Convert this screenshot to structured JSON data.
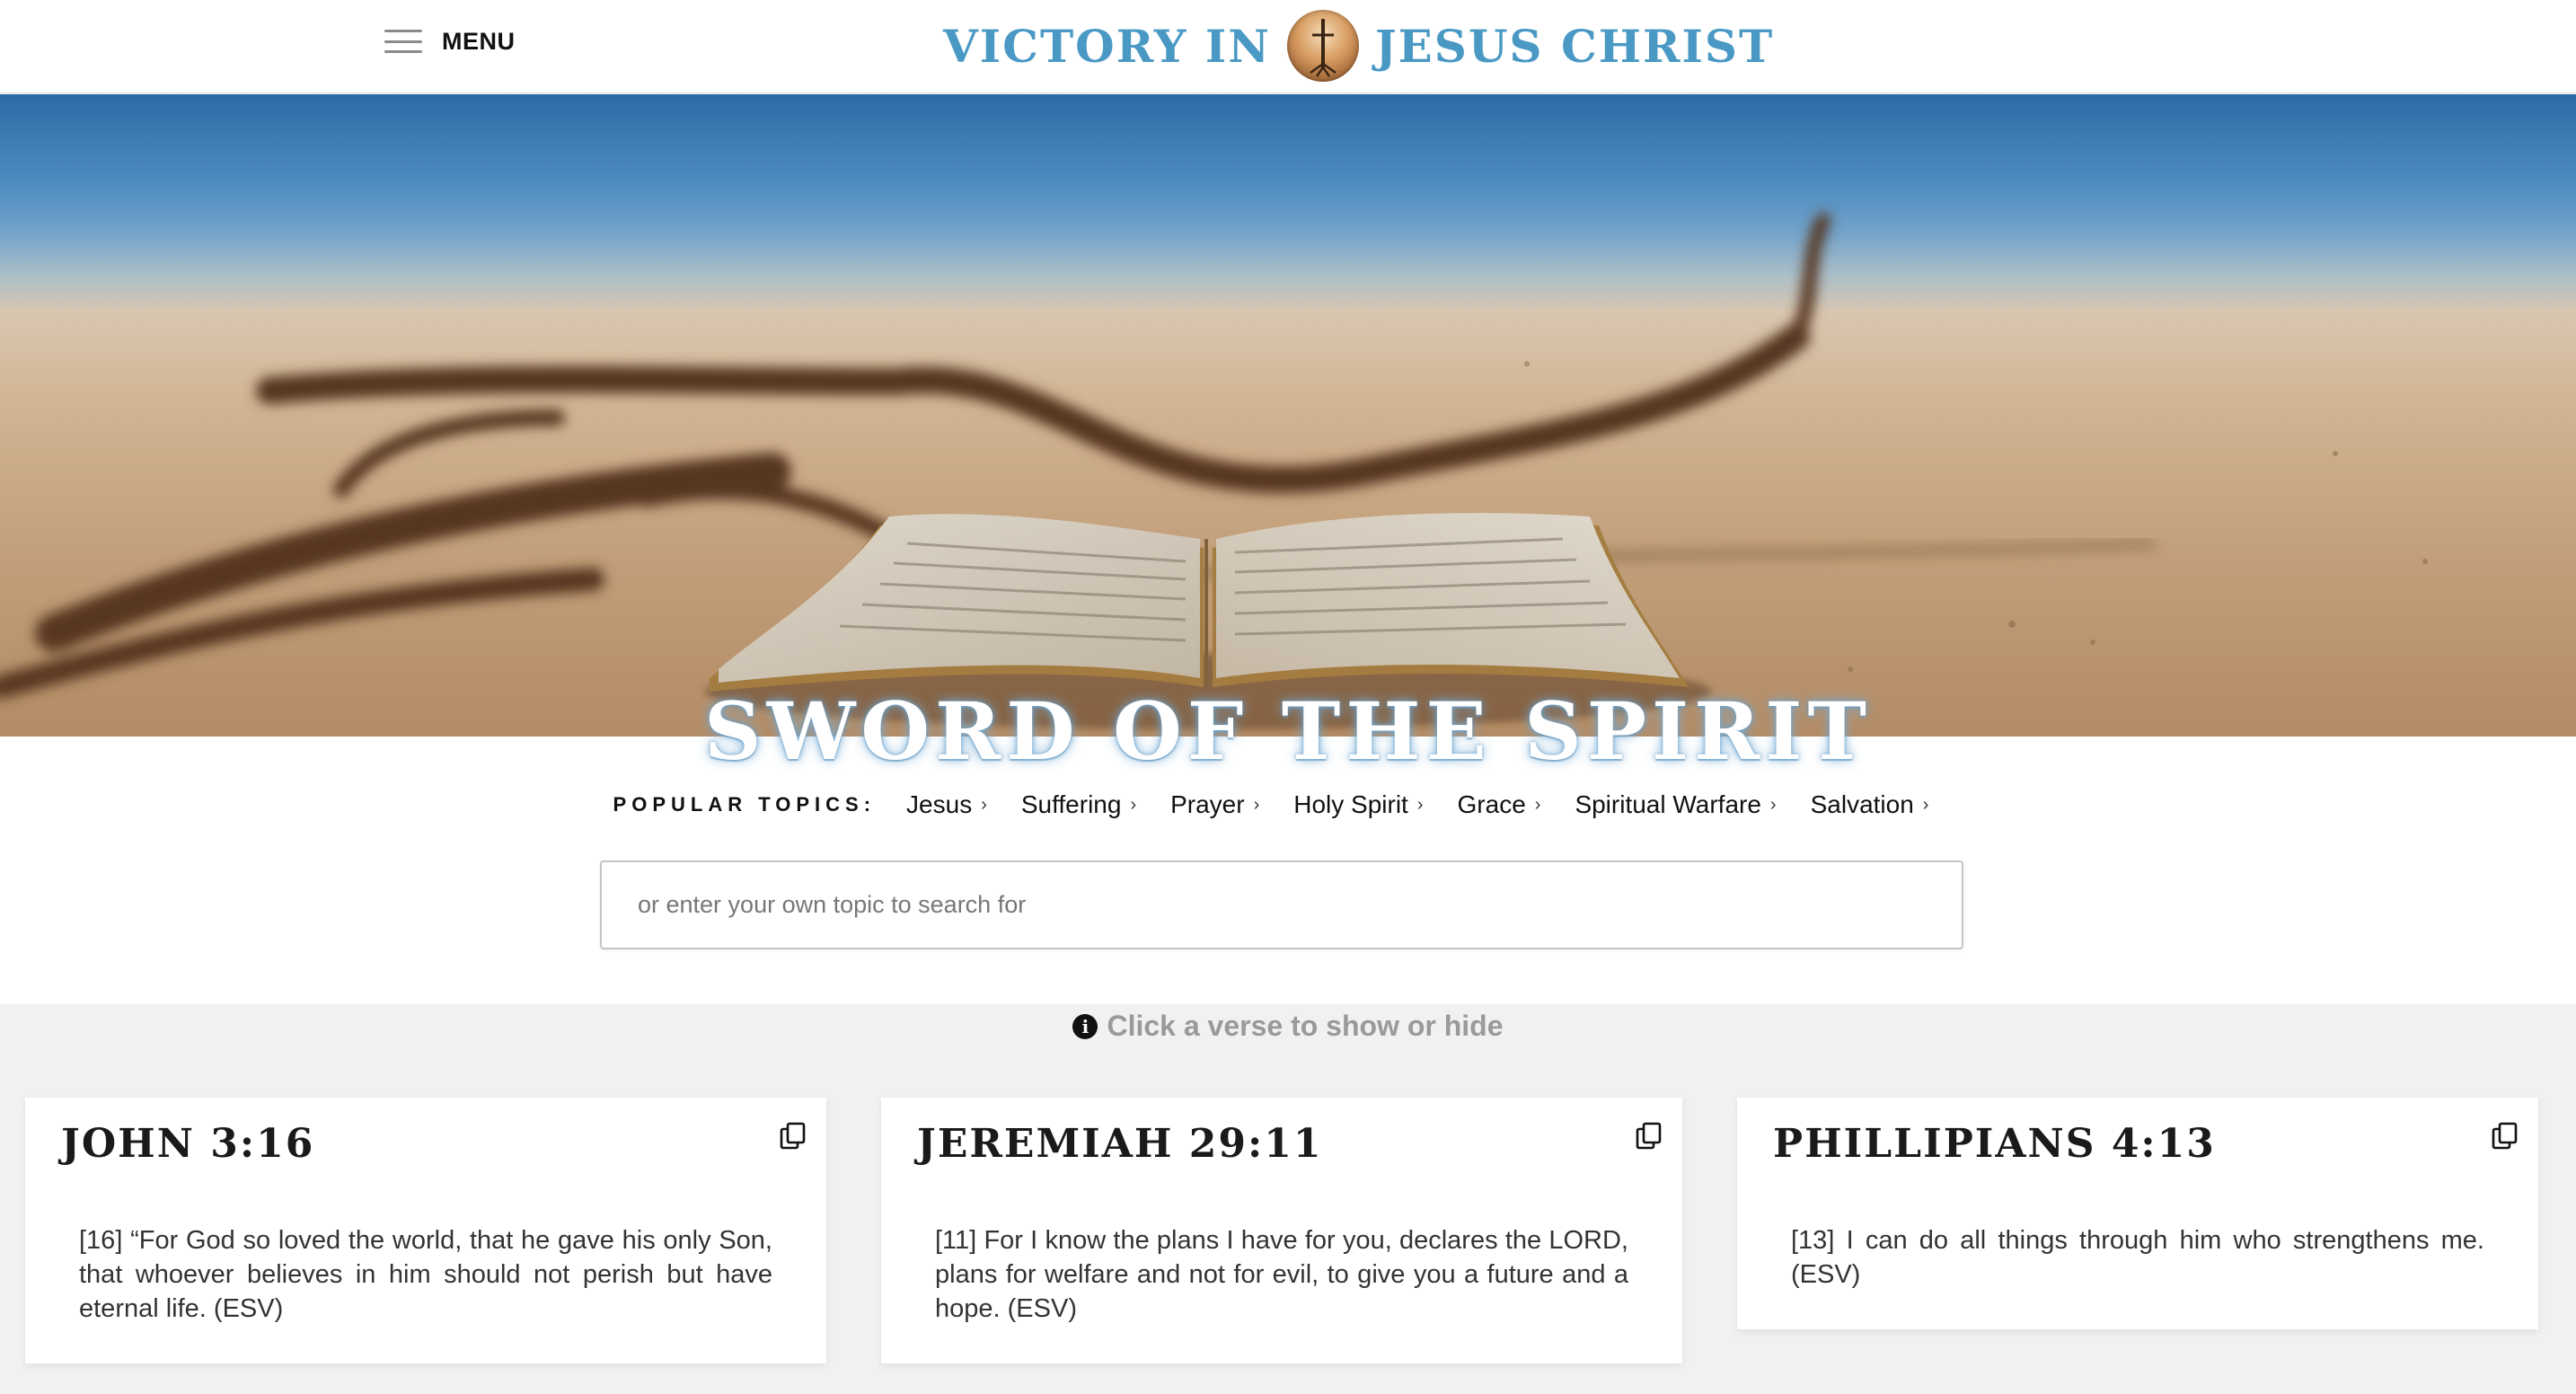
{
  "header": {
    "menu_label": "MENU",
    "logo_left": "VICTORY IN",
    "logo_right": "JESUS CHRIST"
  },
  "hero": {
    "title": "SWORD OF THE SPIRIT"
  },
  "topics": {
    "label": "POPULAR TOPICS:",
    "chevron": "›",
    "items": [
      "Jesus",
      "Suffering",
      "Prayer",
      "Holy Spirit",
      "Grace",
      "Spiritual Warfare",
      "Salvation"
    ]
  },
  "search": {
    "placeholder": "or enter your own topic to search for"
  },
  "hint": {
    "icon_glyph": "i",
    "text": "Click a verse to show or hide"
  },
  "verses": [
    {
      "reference": "JOHN 3:16",
      "text": "[16] “For God so loved the world, that he gave his only Son, that whoever believes in him should not perish but have eternal life. (ESV)"
    },
    {
      "reference": "JEREMIAH 29:11",
      "text": "[11] For I know the plans I have for you, declares the LORD, plans for welfare and not for evil, to give you a future and a hope. (ESV)"
    },
    {
      "reference": "PHILLIPIANS 4:13",
      "text": "[13] I can do all things through him who strengthens me. (ESV)"
    }
  ],
  "icons": {
    "menu": "hamburger-icon",
    "logo": "cross-sunrise-icon",
    "info": "info-icon",
    "copy": "copy-icon"
  },
  "colors": {
    "logo_blue": "#4a99c4",
    "hint_gray": "#9a9a9a",
    "band_gray": "#f1f1f1"
  }
}
